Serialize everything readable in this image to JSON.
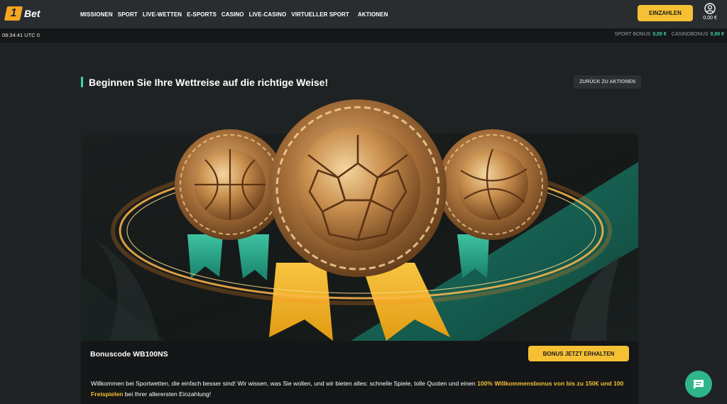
{
  "header": {
    "logo_mark": "1",
    "logo_text": "Bet",
    "nav": [
      "MISSIONEN",
      "SPORT",
      "LIVE-WETTEN",
      "E-SPORTS",
      "CASINO",
      "LIVE-CASINO",
      "VIRTUELLER SPORT",
      "AKTIONEN"
    ],
    "deposit_label": "EINZAHLEN",
    "balance": "0,00 €"
  },
  "subbar": {
    "clock": "08:34:41 UTC 0",
    "sport_bonus_label": "SPORT BONUS",
    "sport_bonus_value": "0,00 €",
    "casino_bonus_label": "CASINOBONUS",
    "casino_bonus_value": "0,00 €"
  },
  "page": {
    "title": "Beginnen Sie Ihre Wettreise auf die richtige Weise!",
    "back_label": "ZURÜCK ZU AKTIONEN"
  },
  "promo": {
    "bonus_code": "Bonuscode WB100NS",
    "cta_label": "BONUS JETZT ERHALTEN",
    "desc_part1": "Willkommen bei Sportwetten, die einfach besser sind! Wir wissen, was Sie wollen, und wir bieten alles: schnelle Spiele, tolle Quoten und einen ",
    "desc_highlight": "100% Willkommensbonus von bis zu 150€ und 100 Freispielen",
    "desc_part2": " bei Ihrer allerersten Einzahlung!"
  },
  "colors": {
    "accent_yellow": "#f5c034",
    "accent_teal": "#3dd6a6",
    "background": "#1f2223",
    "chat_green": "#2fb58a"
  },
  "icons": [
    "user-circle-icon",
    "chat-icon",
    "basketball-medal",
    "football-medal",
    "volleyball-medal"
  ]
}
